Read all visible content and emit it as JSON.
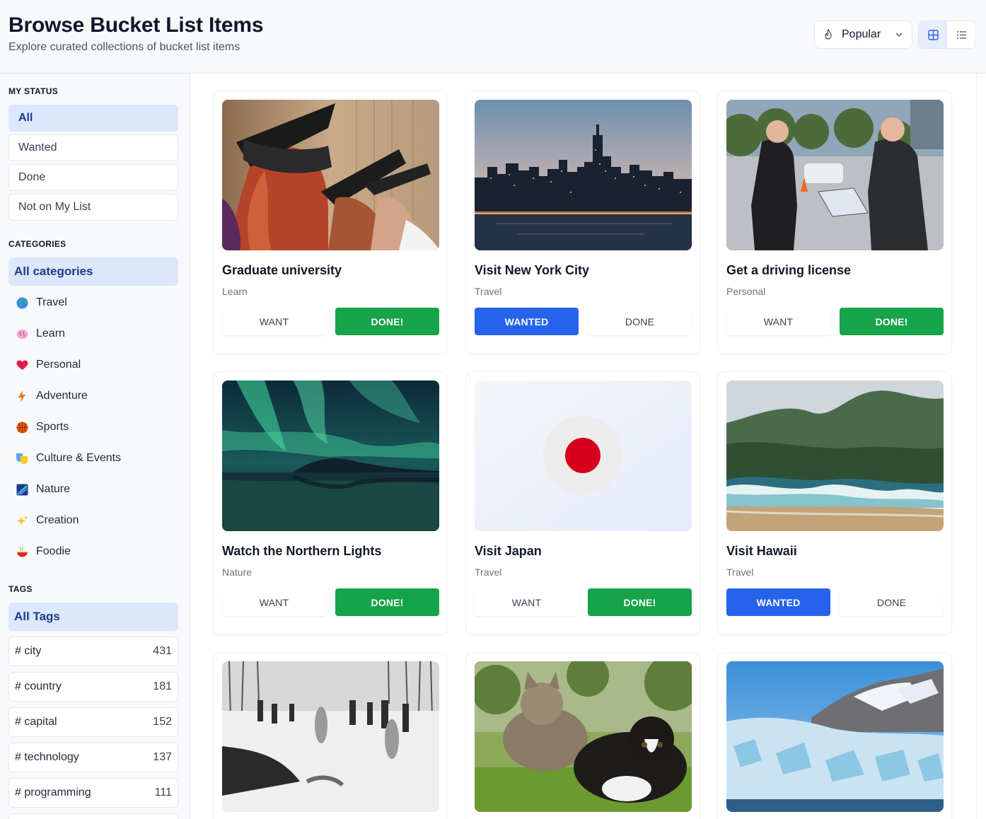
{
  "header": {
    "title": "Browse Bucket List Items",
    "subtitle": "Explore curated collections of bucket list items",
    "sort": {
      "selected": "Popular",
      "icon": "flame-icon"
    },
    "view": {
      "active": "grid"
    }
  },
  "sidebar": {
    "status_heading": "MY STATUS",
    "status": [
      {
        "label": "All",
        "active": true
      },
      {
        "label": "Wanted",
        "active": false
      },
      {
        "label": "Done",
        "active": false
      },
      {
        "label": "Not on My List",
        "active": false
      }
    ],
    "categories_heading": "CATEGORIES",
    "categories_all": "All categories",
    "categories": [
      {
        "label": "Travel",
        "icon": "globe-icon"
      },
      {
        "label": "Learn",
        "icon": "brain-icon"
      },
      {
        "label": "Personal",
        "icon": "heart-icon"
      },
      {
        "label": "Adventure",
        "icon": "lightning-icon"
      },
      {
        "label": "Sports",
        "icon": "basketball-icon"
      },
      {
        "label": "Culture & Events",
        "icon": "theater-masks-icon"
      },
      {
        "label": "Nature",
        "icon": "nature-icon"
      },
      {
        "label": "Creation",
        "icon": "sparkles-icon"
      },
      {
        "label": "Foodie",
        "icon": "noodle-bowl-icon"
      }
    ],
    "tags_heading": "TAGS",
    "tags_all": "All Tags",
    "tags": [
      {
        "label": "# city",
        "count": "431"
      },
      {
        "label": "# country",
        "count": "181"
      },
      {
        "label": "# capital",
        "count": "152"
      },
      {
        "label": "# technology",
        "count": "137"
      },
      {
        "label": "# programming",
        "count": "111"
      }
    ]
  },
  "cards": [
    {
      "title": "Graduate university",
      "category": "Learn",
      "want": "WANT",
      "done": "DONE!",
      "state": "done",
      "image": "graduation"
    },
    {
      "title": "Visit New York City",
      "category": "Travel",
      "want": "WANTED",
      "done": "DONE",
      "state": "wanted",
      "image": "nyc"
    },
    {
      "title": "Get a driving license",
      "category": "Personal",
      "want": "WANT",
      "done": "DONE!",
      "state": "done",
      "image": "driving"
    },
    {
      "title": "Watch the Northern Lights",
      "category": "Nature",
      "want": "WANT",
      "done": "DONE!",
      "state": "done",
      "image": "aurora"
    },
    {
      "title": "Visit Japan",
      "category": "Travel",
      "want": "WANT",
      "done": "DONE!",
      "state": "done",
      "image": "japan"
    },
    {
      "title": "Visit Hawaii",
      "category": "Travel",
      "want": "WANTED",
      "done": "DONE",
      "state": "wanted",
      "image": "hawaii"
    },
    {
      "title": "",
      "category": "",
      "want": "",
      "done": "",
      "state": "",
      "image": "winter-swim"
    },
    {
      "title": "",
      "category": "",
      "want": "",
      "done": "",
      "state": "",
      "image": "cat-dog"
    },
    {
      "title": "",
      "category": "",
      "want": "",
      "done": "",
      "state": "",
      "image": "glacier"
    }
  ],
  "colors": {
    "accent": "#2563eb",
    "done": "#16a34a",
    "active_bg": "#dde7fb"
  }
}
